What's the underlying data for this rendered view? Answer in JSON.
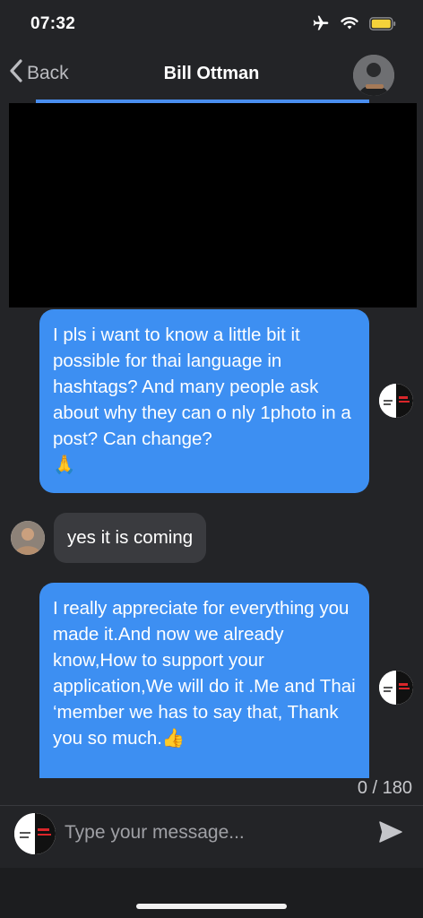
{
  "status_bar": {
    "time": "07:32"
  },
  "nav": {
    "back_label": "Back",
    "title": "Bill Ottman"
  },
  "messages": [
    {
      "direction": "out",
      "text": "I pls i want to know  a little bit it possible for thai language in hashtags? And many people ask about  why they can  o nly 1photo in a post? Can change?",
      "emoji": "🙏"
    },
    {
      "direction": "in",
      "text": "yes it is coming"
    },
    {
      "direction": "out",
      "text": "I really appreciate for everything you made it.And now we already know,How to support your application,We will do it .Me and Thai ‘member we has to say that, Thank you so much.",
      "emoji": "👍"
    }
  ],
  "composer": {
    "counter": "0 / 180",
    "placeholder": "Type your message..."
  },
  "colors": {
    "background": "#232427",
    "outgoing_bubble": "#3d8ff2",
    "incoming_bubble": "#3a3b3f"
  },
  "icons": [
    "airplane-icon",
    "wifi-icon",
    "battery-icon",
    "chevron-left-icon",
    "send-icon"
  ]
}
